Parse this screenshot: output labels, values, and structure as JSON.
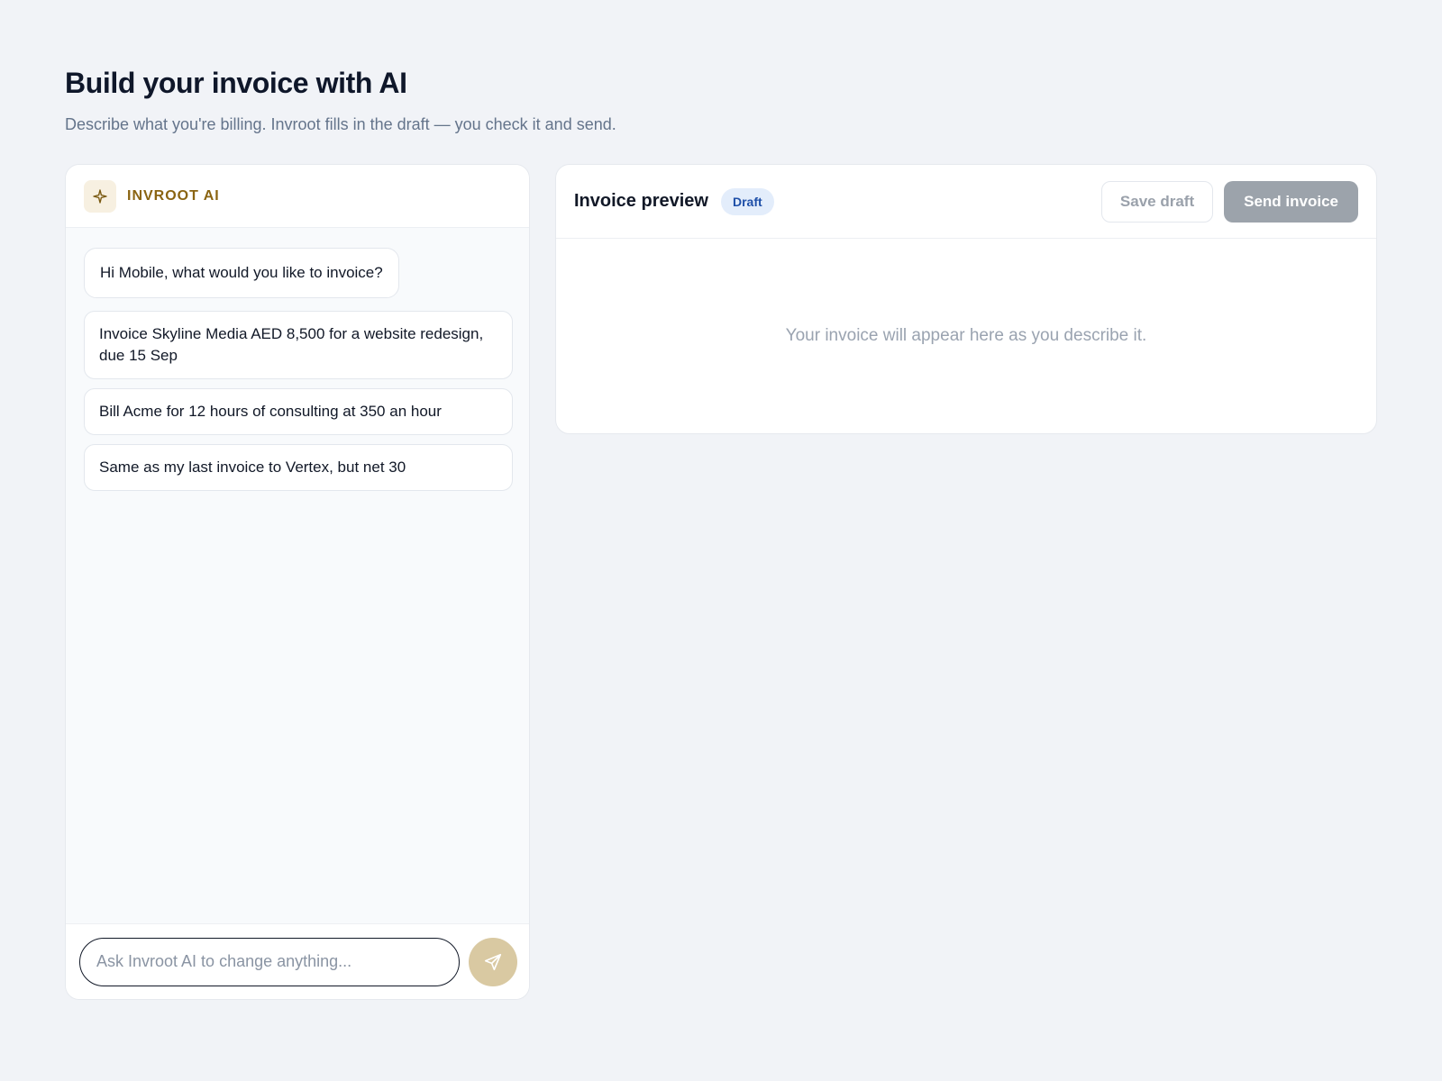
{
  "page": {
    "title": "Build your invoice with AI",
    "subtitle": "Describe what you're billing. Invroot fills in the draft — you check it and send."
  },
  "chat": {
    "assistant_label": "INVROOT AI",
    "assistant_icon": "sparkle-icon",
    "greeting": "Hi Mobile, what would you like to invoice?",
    "suggestions": [
      "Invoice Skyline Media AED 8,500 for a website redesign, due 15 Sep",
      "Bill Acme for 12 hours of consulting at 350 an hour",
      "Same as my last invoice to Vertex, but net 30"
    ],
    "input": {
      "value": "",
      "placeholder": "Ask Invroot AI to change anything..."
    },
    "send_icon": "send-icon"
  },
  "preview": {
    "title": "Invoice preview",
    "status_badge": "Draft",
    "save_label": "Save draft",
    "send_label": "Send invoice",
    "empty_message": "Your invoice will appear here as you describe it."
  },
  "colors": {
    "background": "#f1f3f7",
    "accent_gold": "#8a6412",
    "send_button": "#d9c9a2",
    "badge_blue": "#1e4fa8",
    "disabled_button": "#9ca3ab"
  }
}
